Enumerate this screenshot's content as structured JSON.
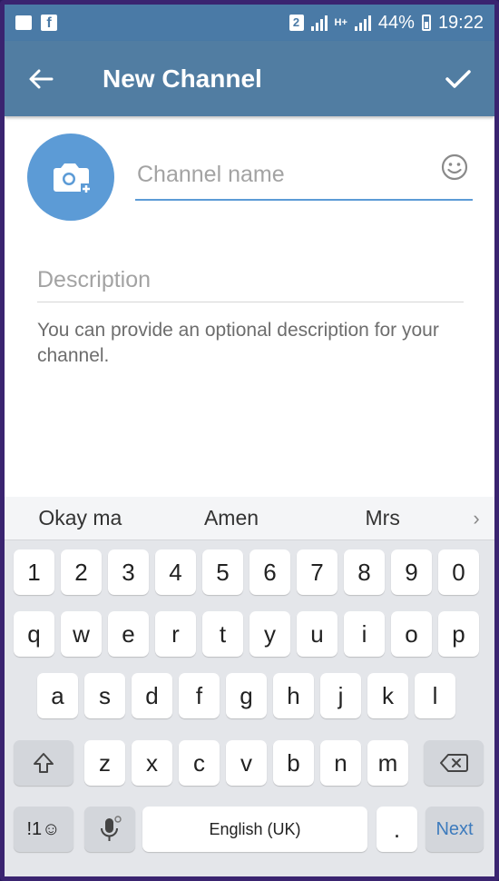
{
  "status_bar": {
    "sim_badge": "2",
    "network": "H+",
    "battery": "44%",
    "time": "19:22"
  },
  "app_bar": {
    "title": "New Channel"
  },
  "form": {
    "name_placeholder": "Channel name",
    "description_placeholder": "Description",
    "hint": "You can provide an optional description for your channel."
  },
  "keyboard": {
    "suggestions": [
      "Okay ma",
      "Amen",
      "Mrs"
    ],
    "number_row": [
      "1",
      "2",
      "3",
      "4",
      "5",
      "6",
      "7",
      "8",
      "9",
      "0"
    ],
    "row1": [
      "q",
      "w",
      "e",
      "r",
      "t",
      "y",
      "u",
      "i",
      "o",
      "p"
    ],
    "row2": [
      "a",
      "s",
      "d",
      "f",
      "g",
      "h",
      "j",
      "k",
      "l"
    ],
    "row3": [
      "z",
      "x",
      "c",
      "v",
      "b",
      "n",
      "m"
    ],
    "symbols_label": "!1☺",
    "space_label": "English (UK)",
    "period_label": ".",
    "next_label": "Next"
  },
  "colors": {
    "status_bar": "#4a7aa6",
    "app_bar": "#517da2",
    "accent": "#5c9bd6"
  }
}
